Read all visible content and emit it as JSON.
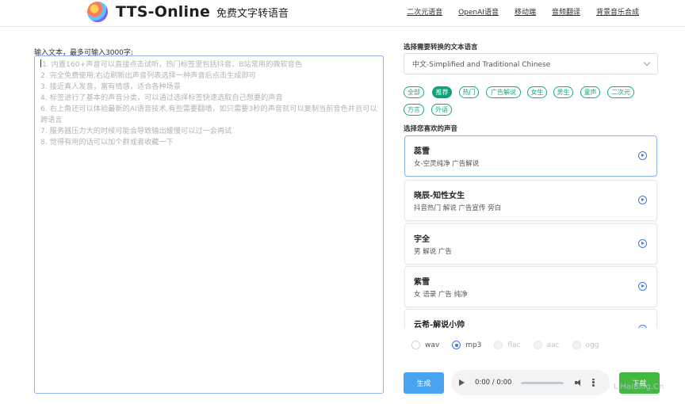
{
  "header": {
    "title": "TTS-Online",
    "subtitle": "免费文字转语音",
    "nav": [
      "二次元语音",
      "OpenAI语音",
      "移动端",
      "音频翻译",
      "背景音乐合成"
    ]
  },
  "input": {
    "label": "输入文本，最多可输入3000字:",
    "placeholder_lines": [
      "1. 内置160+声音可以直接点击试听，热门标签里包括抖音、B站常用的微软音色",
      "2. 完全免费使用,右边刷新出声音列表选择一种声音后点击生成即可",
      "3. 接近真人发音，富有情感，适合各种场景",
      "4. 标签进行了基本的声音分类，可以通过选择标签快速选取自己想要的声音",
      "6. 右上角还可以体验最新的AI语音技术,有些需要翻墙，如只需要3秒的声音就可以复制当前音色并且可以跨语言",
      "7. 服务器压力大的时候可能会导致输出缓慢可以过一会再试",
      "8. 觉得有用的话可以加个群或者收藏一下"
    ]
  },
  "language": {
    "label": "选择需要转换的文本语言",
    "selected": "中文-Simplified and Traditional Chinese"
  },
  "tags": [
    "全部",
    "推荐",
    "热门",
    "广告解说",
    "女生",
    "男生",
    "童声",
    "二次元",
    "方言",
    "外语"
  ],
  "active_tag": "推荐",
  "voices": {
    "label": "选择您喜欢的声音",
    "items": [
      {
        "name": "蕊雪",
        "desc": "女-空灵纯净 广告解说"
      },
      {
        "name": "晓辰-知性女生",
        "desc": "抖音热门 解说 广告宣传 旁白"
      },
      {
        "name": "宇全",
        "desc": "男 解说 广告"
      },
      {
        "name": "紫雪",
        "desc": "女 语录 广告 纯净"
      },
      {
        "name": "云希-解说小帅",
        "desc": ""
      }
    ]
  },
  "formats": [
    "wav",
    "mp3",
    "flac",
    "aac",
    "ogg"
  ],
  "selected_format": "mp3",
  "actions": {
    "generate": "生成",
    "download": "下载"
  },
  "player": {
    "time": "0:00 / 0:00"
  },
  "watermark": "LiHaiBlog.Cn",
  "colors": {
    "accent_green": "#13a07a",
    "generate_blue": "#4aa3f0",
    "download_green": "#43b83f",
    "select_border": "#8ab4f2"
  }
}
